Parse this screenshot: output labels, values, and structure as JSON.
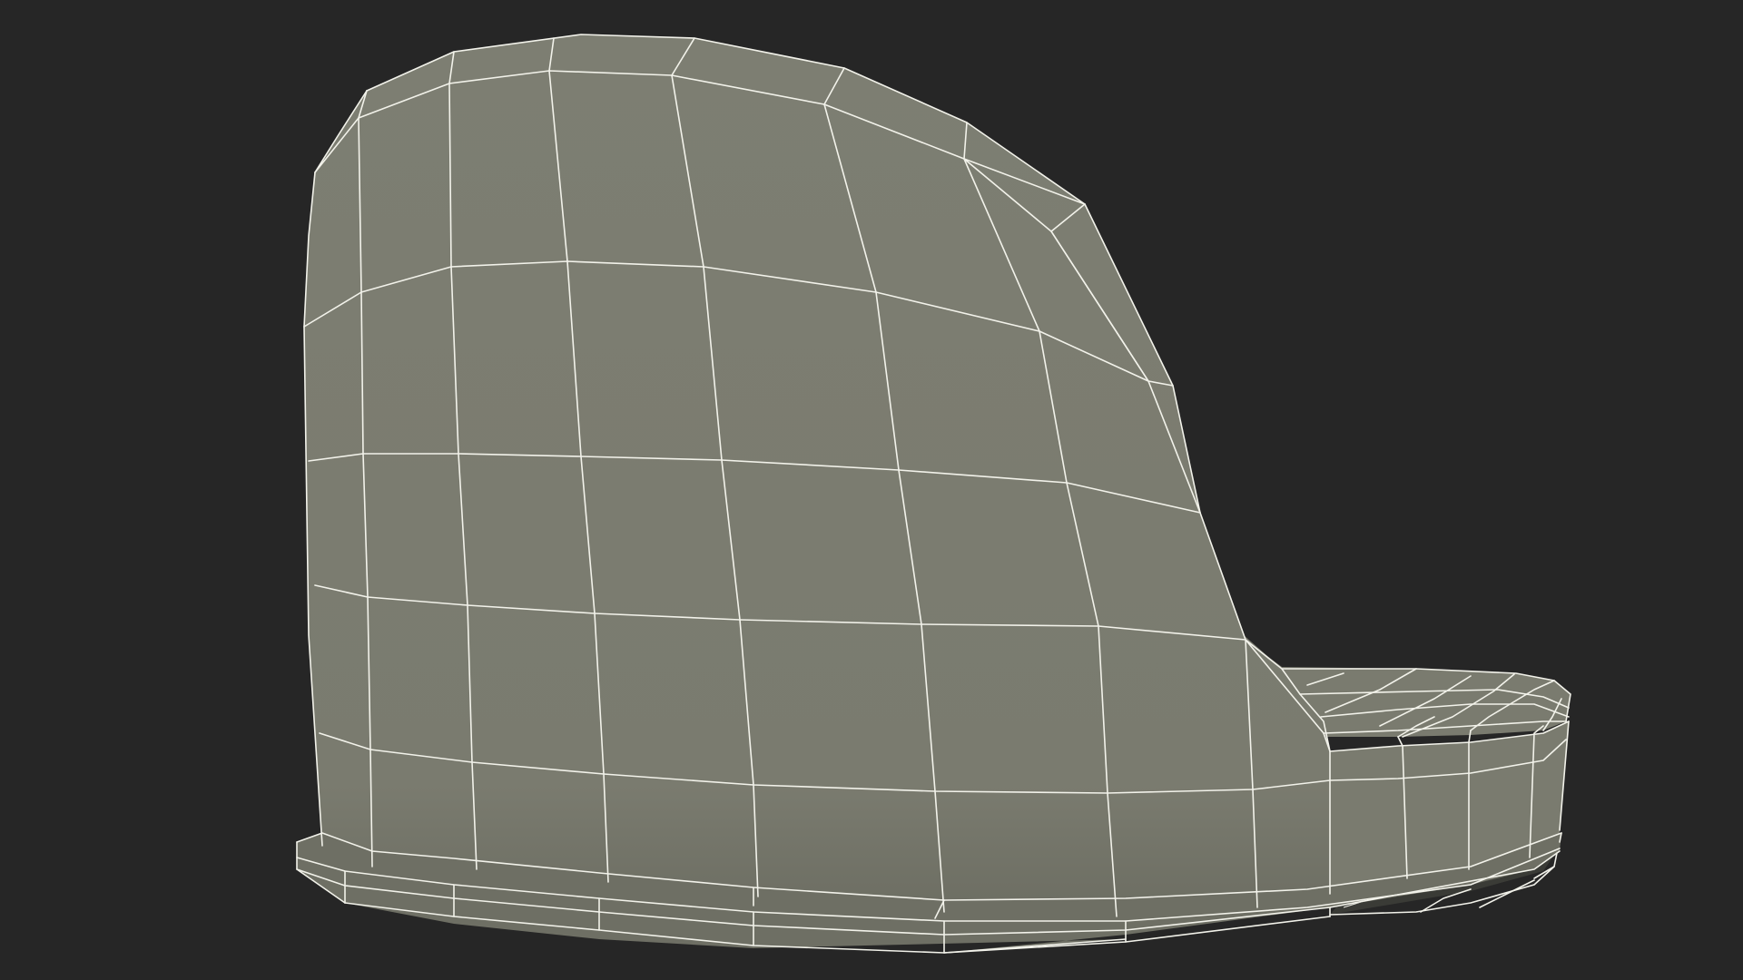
{
  "scene": {
    "subject": "wireframe-3d-model",
    "colors": {
      "background": "#262626",
      "surface": "#7a7b6f",
      "surface_dark": "#6e6f64",
      "underside": "#3a3b36",
      "wire": "#f2f2ea"
    }
  }
}
